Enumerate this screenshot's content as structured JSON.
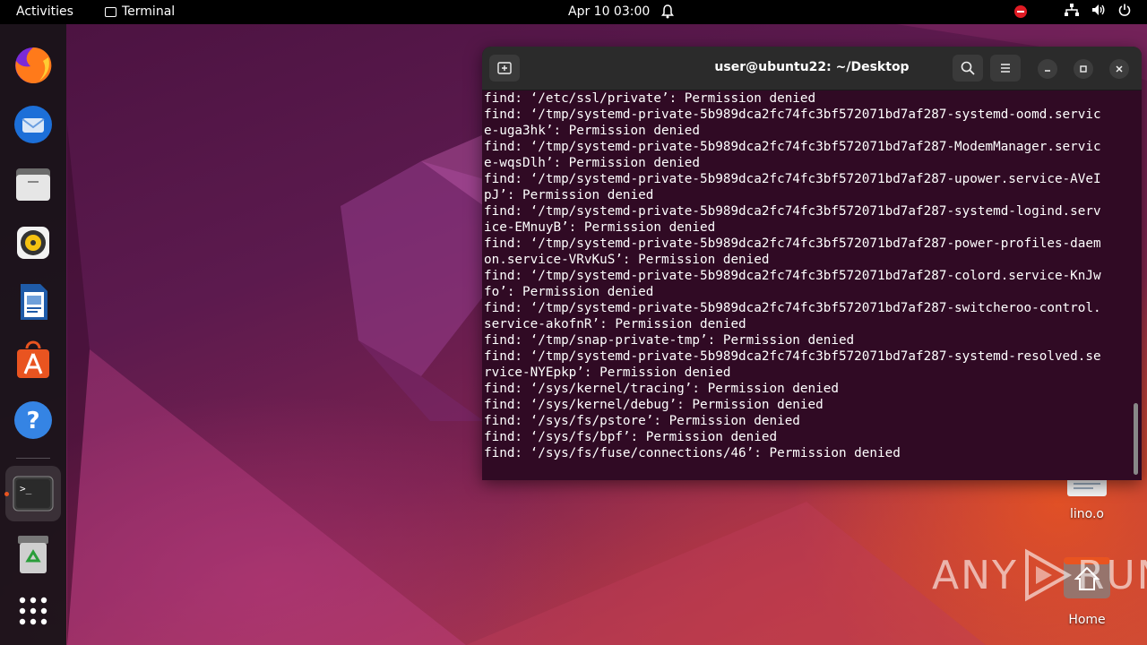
{
  "topbar": {
    "activities": "Activities",
    "app_name": "Terminal",
    "clock": "Apr 10  03:00"
  },
  "dock": {
    "items": [
      "firefox",
      "thunderbird",
      "files",
      "rhythmbox",
      "libreoffice-writer",
      "app-center",
      "help",
      "terminal",
      "trash",
      "show-apps"
    ]
  },
  "terminal": {
    "title": "user@ubuntu22: ~/Desktop",
    "lines": [
      "find: ‘/etc/ssl/private’: Permission denied",
      "find: ‘/tmp/systemd-private-5b989dca2fc74fc3bf572071bd7af287-systemd-oomd.servic",
      "e-uga3hk’: Permission denied",
      "find: ‘/tmp/systemd-private-5b989dca2fc74fc3bf572071bd7af287-ModemManager.servic",
      "e-wqsDlh’: Permission denied",
      "find: ‘/tmp/systemd-private-5b989dca2fc74fc3bf572071bd7af287-upower.service-AVeI",
      "pJ’: Permission denied",
      "find: ‘/tmp/systemd-private-5b989dca2fc74fc3bf572071bd7af287-systemd-logind.serv",
      "ice-EMnuyB’: Permission denied",
      "find: ‘/tmp/systemd-private-5b989dca2fc74fc3bf572071bd7af287-power-profiles-daem",
      "on.service-VRvKuS’: Permission denied",
      "find: ‘/tmp/systemd-private-5b989dca2fc74fc3bf572071bd7af287-colord.service-KnJw",
      "fo’: Permission denied",
      "find: ‘/tmp/systemd-private-5b989dca2fc74fc3bf572071bd7af287-switcheroo-control.",
      "service-akofnR’: Permission denied",
      "find: ‘/tmp/snap-private-tmp’: Permission denied",
      "find: ‘/tmp/systemd-private-5b989dca2fc74fc3bf572071bd7af287-systemd-resolved.se",
      "rvice-NYEpkp’: Permission denied",
      "find: ‘/sys/kernel/tracing’: Permission denied",
      "find: ‘/sys/kernel/debug’: Permission denied",
      "find: ‘/sys/fs/pstore’: Permission denied",
      "find: ‘/sys/fs/bpf’: Permission denied",
      "find: ‘/sys/fs/fuse/connections/46’: Permission denied"
    ]
  },
  "desktop": {
    "icons": [
      {
        "label": "lino.o",
        "icon": "text-file-icon"
      },
      {
        "label": "Home",
        "icon": "home-folder-icon"
      }
    ]
  },
  "watermark": {
    "text_left": "ANY",
    "text_right": "RUN"
  }
}
